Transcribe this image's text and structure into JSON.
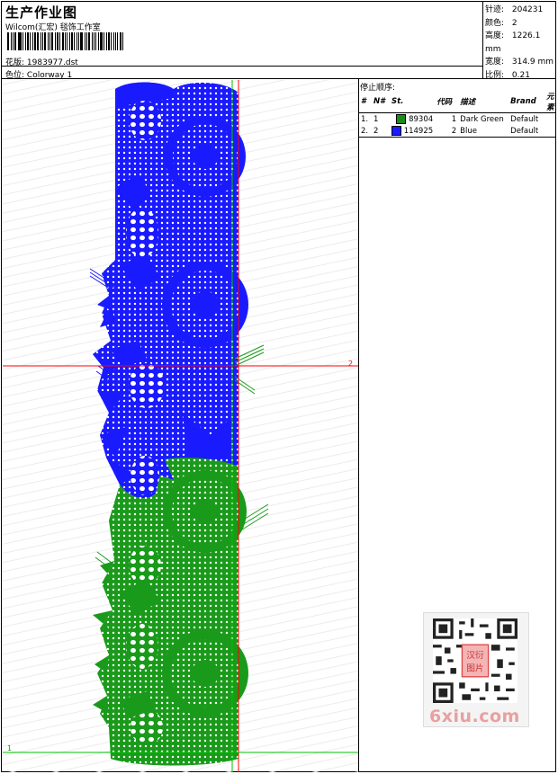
{
  "header": {
    "title": "生产作业图",
    "subtitle": "Wilcom(汇宏) 毯饰工作室",
    "design_label": "花版:",
    "design_value": "1983977.dst",
    "colorway_label": "色位:",
    "colorway_value": "Colorway 1"
  },
  "stats": {
    "stitches_label": "针迹:",
    "stitches_value": "204231",
    "colors_label": "颜色:",
    "colors_value": "2",
    "height_label": "高度:",
    "height_value": "1226.1 mm",
    "width_label": "宽度:",
    "width_value": "314.9 mm",
    "scale_label": "比例:",
    "scale_value": "0.21"
  },
  "stop_sequence": {
    "title": "停止顺序:",
    "columns": [
      "#",
      "N#",
      "St.",
      "代码",
      "描述",
      "Brand",
      "元素"
    ],
    "rows": [
      {
        "idx": "1.",
        "n": "1",
        "color": "#1a8c1a",
        "stitches": "89304",
        "code": "1",
        "desc": "Dark Green",
        "brand": "Default"
      },
      {
        "idx": "2.",
        "n": "2",
        "color": "#1a1aff",
        "stitches": "114925",
        "code": "2",
        "desc": "Blue",
        "brand": "Default"
      }
    ]
  },
  "canvas": {
    "marker_right": "2",
    "marker_left": "1",
    "blue": "#1a1aff",
    "green": "#1a9a1a",
    "crosshair": "#ff0000",
    "guide_green": "#00c000"
  },
  "watermark": {
    "text": "6xiu.com",
    "seal": "汉衍图片"
  }
}
